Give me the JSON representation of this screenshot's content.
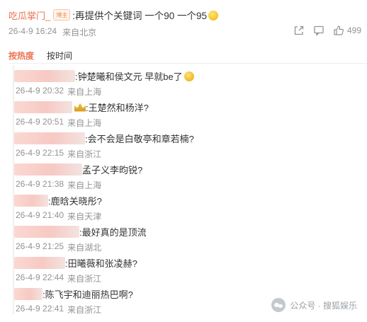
{
  "post": {
    "author": "吃瓜掌门_",
    "badge": "博主",
    "text": ":再提供个关键词 一个90 一个95",
    "date": "26-4-9 16:24",
    "location": "来自北京",
    "likes": "499"
  },
  "tabs": [
    "按热度",
    "按时间"
  ],
  "replies": [
    {
      "text": ":钟楚曦和侯文元 早就be了",
      "date": "26-4-9 20:32",
      "location": "来自上海"
    },
    {
      "text": ":王楚然和杨洋?",
      "date": "26-4-9 20:51",
      "location": "来自上海"
    },
    {
      "text": ":会不会是白敬亭和章若楠?",
      "date": "26-4-9 22:15",
      "location": "来自浙江"
    },
    {
      "text": "孟子义李昀锐?",
      "date": "26-4-9 21:38",
      "location": "来自上海"
    },
    {
      "text": ":鹿晗关晓彤?",
      "date": "26-4-9 21:40",
      "location": "来自天津"
    },
    {
      "text": ":最好真的是顶流",
      "date": "26-4-9 21:25",
      "location": "来自湖北"
    },
    {
      "text": ":田曦薇和张凌赫?",
      "date": "26-4-9 22:44",
      "location": "来自浙江"
    },
    {
      "text": ":陈飞宇和迪丽热巴啊?",
      "date": "26-4-9 22:41",
      "location": "来自浙江"
    }
  ],
  "watermark": "公众号 · 搜狐娱乐"
}
